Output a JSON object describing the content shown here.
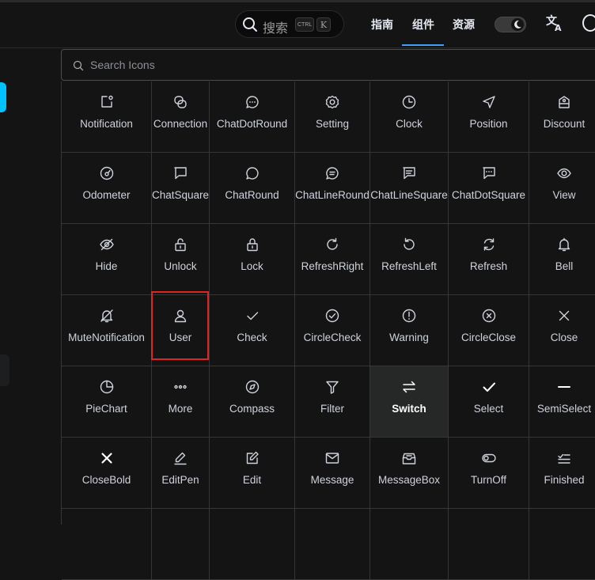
{
  "header": {
    "search_placeholder": "搜索",
    "ctrl_key": "CTRL",
    "k_key": "K",
    "nav": [
      "指南",
      "组件",
      "资源"
    ],
    "active_nav": "组件",
    "accent_color": "#409eff",
    "translate_icon": "translate-icon",
    "theme_toggle": "dark",
    "github_icon": "github-icon"
  },
  "search": {
    "placeholder": "Search Icons",
    "value": ""
  },
  "icons": [
    {
      "name": "Notification",
      "icon": "notification-icon"
    },
    {
      "name": "Connection",
      "icon": "connection-icon"
    },
    {
      "name": "ChatDotRound",
      "icon": "chat-dot-round-icon"
    },
    {
      "name": "Setting",
      "icon": "setting-icon"
    },
    {
      "name": "Clock",
      "icon": "clock-icon"
    },
    {
      "name": "Position",
      "icon": "position-icon"
    },
    {
      "name": "Discount",
      "icon": "discount-icon"
    },
    {
      "name": "Odometer",
      "icon": "odometer-icon"
    },
    {
      "name": "ChatSquare",
      "icon": "chat-square-icon"
    },
    {
      "name": "ChatRound",
      "icon": "chat-round-icon"
    },
    {
      "name": "ChatLineRound",
      "icon": "chat-line-round-icon"
    },
    {
      "name": "ChatLineSquare",
      "icon": "chat-line-square-icon"
    },
    {
      "name": "ChatDotSquare",
      "icon": "chat-dot-square-icon"
    },
    {
      "name": "View",
      "icon": "view-icon"
    },
    {
      "name": "Hide",
      "icon": "hide-icon"
    },
    {
      "name": "Unlock",
      "icon": "unlock-icon"
    },
    {
      "name": "Lock",
      "icon": "lock-icon"
    },
    {
      "name": "RefreshRight",
      "icon": "refresh-right-icon"
    },
    {
      "name": "RefreshLeft",
      "icon": "refresh-left-icon"
    },
    {
      "name": "Refresh",
      "icon": "refresh-icon"
    },
    {
      "name": "Bell",
      "icon": "bell-icon"
    },
    {
      "name": "MuteNotification",
      "icon": "mute-notification-icon"
    },
    {
      "name": "User",
      "icon": "user-icon"
    },
    {
      "name": "Check",
      "icon": "check-icon"
    },
    {
      "name": "CircleCheck",
      "icon": "circle-check-icon"
    },
    {
      "name": "Warning",
      "icon": "warning-icon"
    },
    {
      "name": "CircleClose",
      "icon": "circle-close-icon"
    },
    {
      "name": "Close",
      "icon": "close-icon"
    },
    {
      "name": "PieChart",
      "icon": "pie-chart-icon"
    },
    {
      "name": "More",
      "icon": "more-icon"
    },
    {
      "name": "Compass",
      "icon": "compass-icon"
    },
    {
      "name": "Filter",
      "icon": "filter-icon"
    },
    {
      "name": "Switch",
      "icon": "switch-icon"
    },
    {
      "name": "Select",
      "icon": "select-icon"
    },
    {
      "name": "SemiSelect",
      "icon": "semi-select-icon"
    },
    {
      "name": "CloseBold",
      "icon": "close-bold-icon"
    },
    {
      "name": "EditPen",
      "icon": "edit-pen-icon"
    },
    {
      "name": "Edit",
      "icon": "edit-icon"
    },
    {
      "name": "Message",
      "icon": "message-icon"
    },
    {
      "name": "MessageBox",
      "icon": "message-box-icon"
    },
    {
      "name": "TurnOff",
      "icon": "turn-off-icon"
    },
    {
      "name": "Finished",
      "icon": "finished-icon"
    }
  ],
  "hovered_icon": "Switch",
  "selected_icon": "User",
  "selection_color": "#e02424"
}
